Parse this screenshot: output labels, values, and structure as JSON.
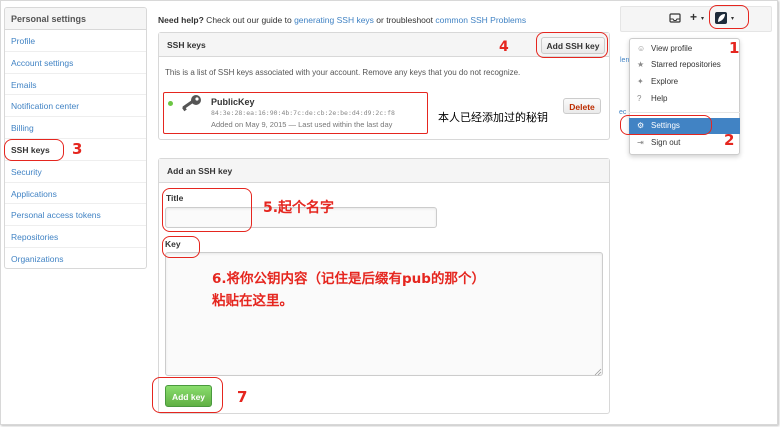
{
  "sidebar": {
    "heading": "Personal settings",
    "items": [
      {
        "label": "Profile"
      },
      {
        "label": "Account settings"
      },
      {
        "label": "Emails"
      },
      {
        "label": "Notification center"
      },
      {
        "label": "Billing"
      },
      {
        "label": "SSH keys",
        "active": true
      },
      {
        "label": "Security"
      },
      {
        "label": "Applications"
      },
      {
        "label": "Personal access tokens"
      },
      {
        "label": "Repositories"
      },
      {
        "label": "Organizations"
      }
    ]
  },
  "help": {
    "prefix": "Need help?",
    "text1": " Check out our guide to ",
    "link1": "generating SSH keys",
    "text2": " or troubleshoot ",
    "link2": "common SSH Problems"
  },
  "ssh_keys": {
    "heading": "SSH keys",
    "add_button": "Add SSH key",
    "description": "This is a list of SSH keys associated with your account. Remove any keys that you do not recognize.",
    "key": {
      "name": "PublicKey",
      "fingerprint": "84:3e:28:ea:16:90:4b:7c:de:cb:2e:be:d4:d9:2c:f8",
      "added": "Added on May 9, 2015 — Last used within the last day",
      "delete_label": "Delete"
    }
  },
  "add_key": {
    "heading": "Add an SSH key",
    "title_label": "Title",
    "title_value": "",
    "key_label": "Key",
    "key_value": "",
    "submit_label": "Add key"
  },
  "header": {
    "plus": "+",
    "icons": [
      "inbox-icon",
      "plus-icon",
      "avatar"
    ]
  },
  "dropdown": {
    "items": [
      {
        "label": "View profile",
        "icon": "person-icon"
      },
      {
        "label": "Starred repositories",
        "icon": "star-icon"
      },
      {
        "label": "Explore",
        "icon": "telescope-icon"
      },
      {
        "label": "Help",
        "icon": "question-icon"
      },
      {
        "label": "Settings",
        "icon": "gear-icon",
        "active": true
      },
      {
        "label": "Sign out",
        "icon": "sign-out-icon"
      }
    ]
  },
  "edge_fragments": {
    "a": "len",
    "b": "ec"
  },
  "annotations": {
    "n1": "1",
    "n2": "2",
    "n3": "3",
    "n4": "4",
    "n5": "5.起个名字",
    "n6_line1": "6.将你公钥内容（记住是后缀有pub的那个）",
    "n6_line2": "粘贴在这里。",
    "n7": "7",
    "note": "本人已经添加过的秘钥"
  },
  "colors": {
    "link": "#4183c4",
    "annotation_red": "#e5261f",
    "green_button": "#60b044",
    "active_menu": "#4183c4"
  }
}
